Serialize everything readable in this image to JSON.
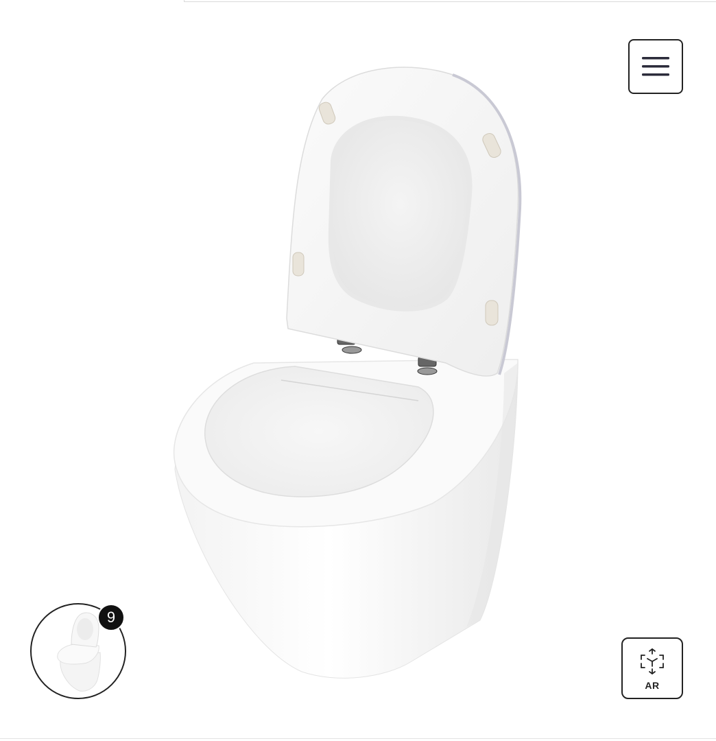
{
  "viewer": {
    "product_image_name": "toilet-3d-model",
    "image_count": "9",
    "ar_label": "AR"
  },
  "icons": {
    "menu": "hamburger-icon",
    "ar": "ar-cube-icon"
  }
}
